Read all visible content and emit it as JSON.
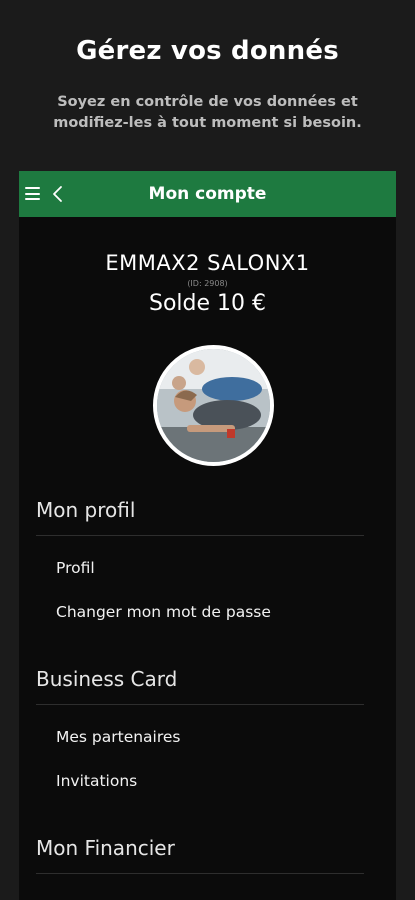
{
  "promo": {
    "title": "Gérez vos donnés",
    "subtitle": "Soyez en contrôle de vos données et modifiez-les à tout moment si besoin."
  },
  "appbar": {
    "title": "Mon compte",
    "menu_icon": "hamburger-menu-icon",
    "back_icon": "chevron-left-icon"
  },
  "account": {
    "name": "EMMAX2 SALONX1",
    "id": "(ID: 2908)",
    "balance": "Solde 10 €"
  },
  "sections": {
    "profile": {
      "title": "Mon profil",
      "items": [
        "Profil",
        "Changer mon mot de passe"
      ]
    },
    "business": {
      "title": "Business Card",
      "items": [
        "Mes partenaires",
        "Invitations"
      ]
    },
    "financial": {
      "title": "Mon Financier"
    }
  },
  "colors": {
    "appbar": "#1e7a40",
    "background": "#1b1b1b",
    "device": "#0b0b0b"
  }
}
